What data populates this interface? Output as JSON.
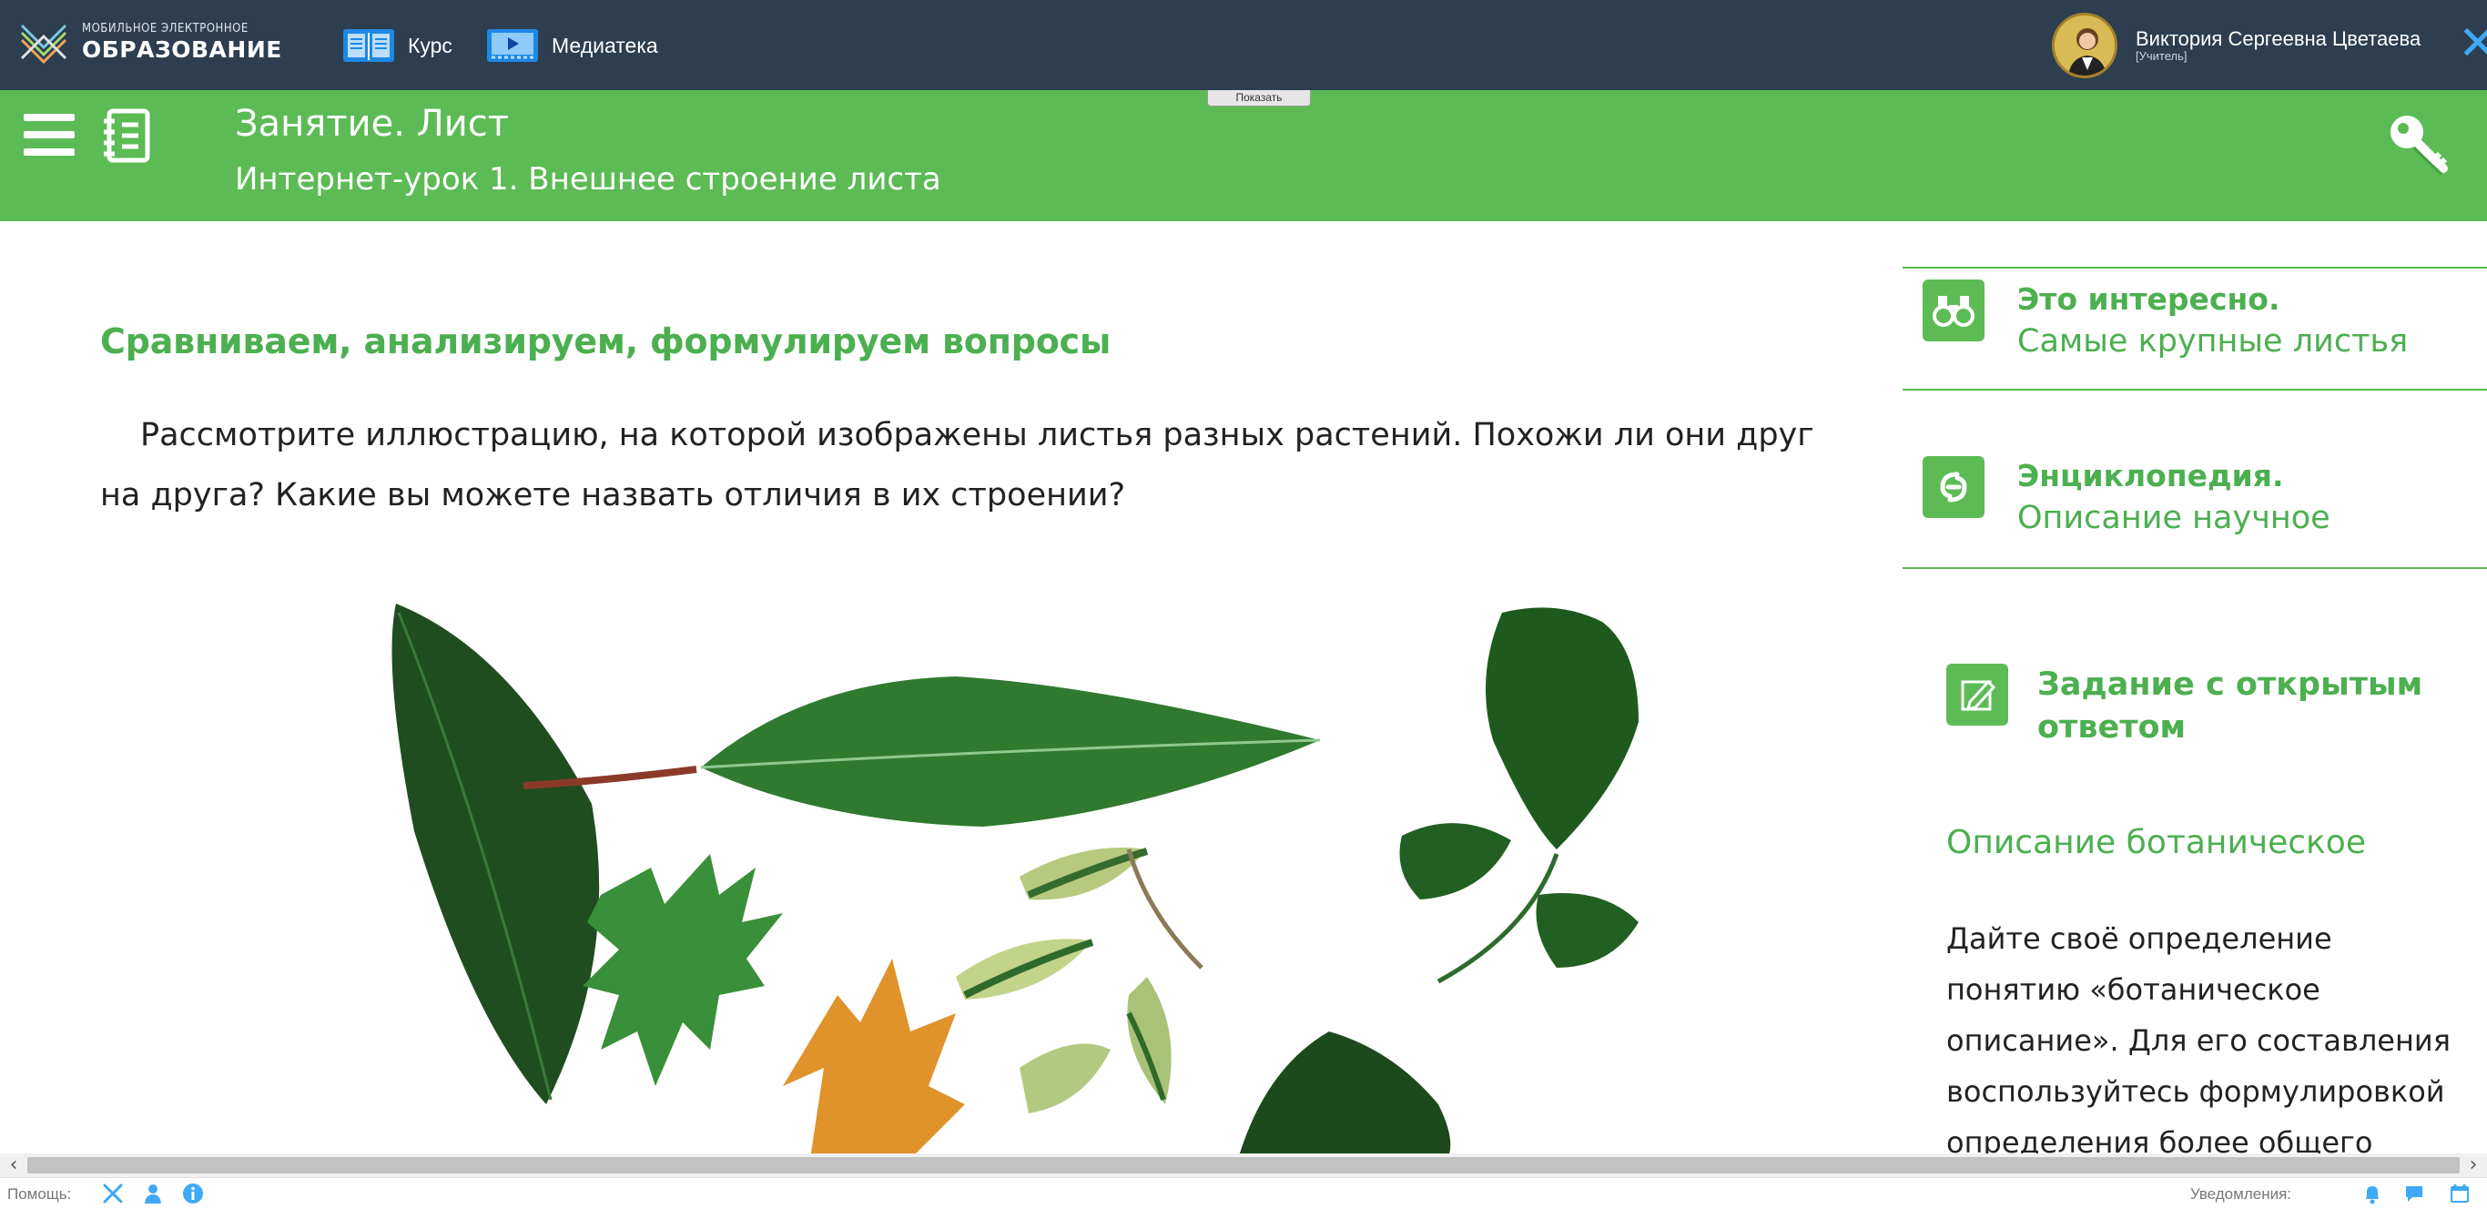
{
  "topbar": {
    "logo_small": "МОБИЛЬНОЕ ЭЛЕКТРОННОЕ",
    "logo_big": "ОБРАЗОВАНИЕ",
    "nav": [
      {
        "label": "Курс",
        "icon": "book-icon"
      },
      {
        "label": "Медиатека",
        "icon": "video-icon"
      }
    ],
    "user": {
      "name": "Виктория Сергеевна Цветаева",
      "role": "[Учитель]"
    },
    "close_glyph": "✕"
  },
  "header": {
    "title": "Занятие. Лист",
    "subtitle": "Интернет-урок 1. Внешнее строение листа",
    "show_button": "Показать"
  },
  "content": {
    "section_title": "Сравниваем, анализируем, формулируем вопросы",
    "paragraph": "Рассмотрите иллюстрацию, на которой изображены листья разных растений. Похожи ли они друг на друга? Какие вы можете назвать отличия в их строении?"
  },
  "sidebar": {
    "items": [
      {
        "heading": "Это интересно.",
        "text": "Самые крупные листья",
        "icon": "binoculars-icon"
      },
      {
        "heading": "Энциклопедия.",
        "text": "Описание научное",
        "icon": "link-icon"
      }
    ],
    "task": {
      "title": "Задание с открытым ответом",
      "icon": "pencil-icon",
      "description_title": "Описание ботаническое",
      "description": "Дайте своё определение понятию «ботаническое описание». Для его составления воспользуйтесь формулировкой определения более общего понятия — «научное"
    }
  },
  "scrollbar": {
    "left_arrow": "‹",
    "right_arrow": "›"
  },
  "footer": {
    "help_label": "Помощь:",
    "notifications_label": "Уведомления:"
  },
  "colors": {
    "topbar": "#2c3e50",
    "green": "#5cbb55",
    "accent_text": "#4caf50",
    "close": "#3fa9f5"
  }
}
